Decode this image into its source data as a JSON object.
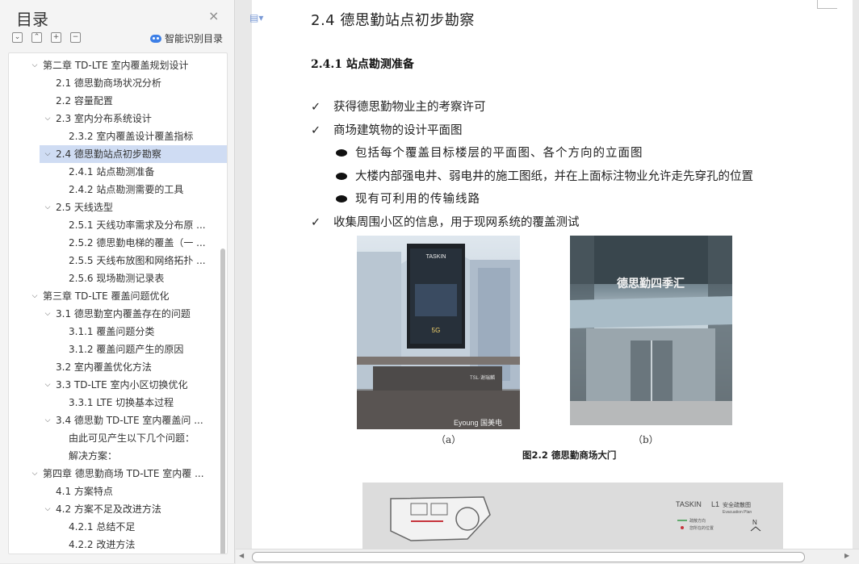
{
  "sidebar": {
    "title": "目录",
    "close_icon": "×",
    "tools": [
      {
        "name": "collapse-all-icon",
        "glyph": "⌄"
      },
      {
        "name": "expand-all-icon",
        "glyph": "⌃"
      },
      {
        "name": "add-entry-icon",
        "glyph": "+"
      },
      {
        "name": "remove-entry-icon",
        "glyph": "−"
      }
    ],
    "smart_toc_label": "智能识别目录",
    "toc": [
      {
        "label": "第二章 TD-LTE 室内覆盖规划设计",
        "caret": true
      },
      {
        "label": "2.1 德思勤商场状况分析",
        "caret": false
      },
      {
        "label": "2.2 容量配置",
        "caret": false
      },
      {
        "label": "2.3 室内分布系统设计",
        "caret": true
      },
      {
        "label": "2.3.2 室内覆盖设计覆盖指标",
        "caret": false
      },
      {
        "label": "2.4 德思勤站点初步勘察",
        "caret": true,
        "selected": true
      },
      {
        "label": "2.4.1 站点勘测准备",
        "caret": false
      },
      {
        "label": "2.4.2 站点勘测需要的工具",
        "caret": false
      },
      {
        "label": "2.5 天线选型",
        "caret": true
      },
      {
        "label": "2.5.1 天线功率需求及分布原 ...",
        "caret": false
      },
      {
        "label": "2.5.2 德思勤电梯的覆盖（一 ...",
        "caret": false
      },
      {
        "label": "2.5.5 天线布放图和网络拓扑 ...",
        "caret": false
      },
      {
        "label": "2.5.6 现场勘测记录表",
        "caret": false
      },
      {
        "label": "第三章 TD-LTE 覆盖问题优化",
        "caret": true
      },
      {
        "label": "3.1 德思勤室内覆盖存在的问题",
        "caret": true
      },
      {
        "label": "3.1.1 覆盖问题分类",
        "caret": false
      },
      {
        "label": "3.1.2 覆盖问题产生的原因",
        "caret": false
      },
      {
        "label": "3.2 室内覆盖优化方法",
        "caret": false
      },
      {
        "label": "3.3 TD-LTE 室内小区切换优化",
        "caret": true
      },
      {
        "label": "3.3.1 LTE 切换基本过程",
        "caret": false
      },
      {
        "label": "3.4 德思勤 TD-LTE 室内覆盖问 ...",
        "caret": true
      },
      {
        "label": "由此可见产生以下几个问题：",
        "caret": false
      },
      {
        "label": "解决方案：",
        "caret": false
      },
      {
        "label": "第四章 德思勤商场 TD-LTE 室内覆 ...",
        "caret": true
      },
      {
        "label": "4.1 方案特点",
        "caret": false
      },
      {
        "label": "4.2 方案不足及改进方法",
        "caret": true
      },
      {
        "label": "4.2.1 总结不足",
        "caret": false
      },
      {
        "label": "4.2.2 改进方法",
        "caret": false
      }
    ]
  },
  "document": {
    "h2": "2.4  德思勤站点初步勘察",
    "h3": "2.4.1 站点勘测准备",
    "check_mark": "✓",
    "check_lines": [
      "获得德思勤物业主的考察许可",
      "商场建筑物的设计平面图",
      "收集周围小区的信息，用于现网系统的覆盖测试"
    ],
    "bullets": [
      "包括每个覆盖目标楼层的平面图、各个方向的立面图",
      "大楼内部强电井、弱电井的施工图纸，并在上面标注物业允许走先穿孔的位置",
      "现有可利用的传输线路"
    ],
    "photo_a_caption": "（a）",
    "photo_b_caption": "（b）",
    "figure_caption": "图2.2 德思勤商场大门",
    "photo_a_texts": {
      "brand": "TASKIN",
      "tag": "5G",
      "store": "TSL·谢瑞麟",
      "bottom": "Eyoung  国美电"
    },
    "photo_b_texts": {
      "sign": "德思勤四季汇"
    },
    "plan_texts": {
      "brand": "TASKIN",
      "floor": "L1",
      "title": "安全疏散图",
      "subtitle": "Evacuation Plan",
      "legend1": "疏散方向",
      "legend2": "您所在的位置",
      "north": "N"
    }
  },
  "scrollbar": {
    "left_arrow": "◀",
    "right_arrow": "▶"
  }
}
